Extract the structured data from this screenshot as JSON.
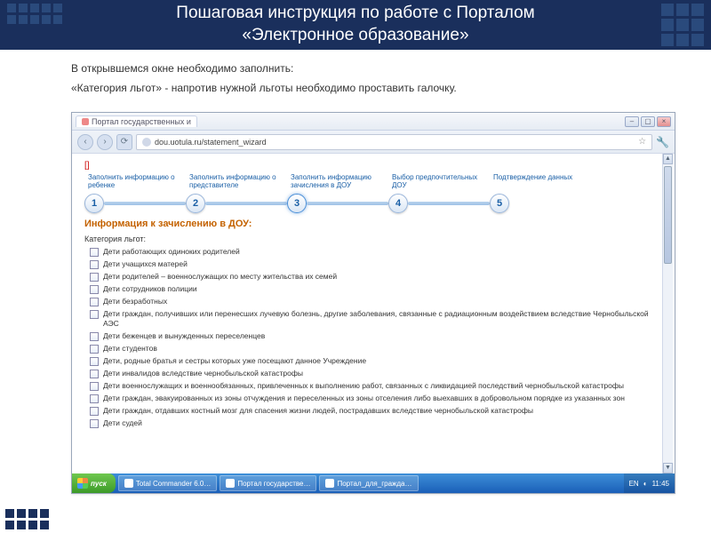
{
  "header": {
    "title_line1": "Пошаговая инструкция по работе с Порталом",
    "title_line2": "«Электронное образование»"
  },
  "slide": {
    "intro": "В открывшемся окне необходимо заполнить:",
    "instruction": "«Категория льгот» - напротив нужной льготы необходимо проставить галочку."
  },
  "browser": {
    "tab_title": "Портал государственных и",
    "url": "dou.uotula.ru/statement_wizard",
    "required_marker": "[]",
    "wizard_steps": [
      {
        "num": "1",
        "label": "Заполнить информацию о ребенке"
      },
      {
        "num": "2",
        "label": "Заполнить информацию о представителе"
      },
      {
        "num": "3",
        "label": "Заполнить информацию зачисления в ДОУ"
      },
      {
        "num": "4",
        "label": "Выбор предпочтительных ДОУ"
      },
      {
        "num": "5",
        "label": "Подтверждение данных"
      }
    ],
    "active_step": 3,
    "section_title": "Информация к зачислению в ДОУ:",
    "subsection": "Категория льгот:",
    "categories": [
      "Дети работающих одиноких родителей",
      "Дети учащихся матерей",
      "Дети родителей – военнослужащих по месту жительства их семей",
      "Дети сотрудников полиции",
      "Дети безработных",
      "Дети граждан, получивших или перенесших лучевую болезнь, другие заболевания, связанные с радиационным воздействием вследствие Чернобыльской АЭС",
      "Дети беженцев и вынужденных переселенцев",
      "Дети студентов",
      "Дети, родные братья и сестры которых уже посещают данное Учреждение",
      "Дети инвалидов вследствие чернобыльской катастрофы",
      "Дети военнослужащих и военнообязанных, привлеченных к выполнению работ, связанных с ликвидацией последствий чернобыльской катастрофы",
      "Дети граждан, эвакуированных из зоны отчуждения и переселенных из зоны отселения либо выехавших в добровольном порядке из указанных зон",
      "Дети граждан, отдавших костный мозг для спасения жизни людей, пострадавших вследствие чернобыльской катастрофы",
      "Дети судей"
    ]
  },
  "taskbar": {
    "start": "пуск",
    "items": [
      "Total Commander 6.0…",
      "Портал государстве…",
      "Портал_для_гражда…"
    ],
    "lang": "EN",
    "time": "11:45"
  }
}
